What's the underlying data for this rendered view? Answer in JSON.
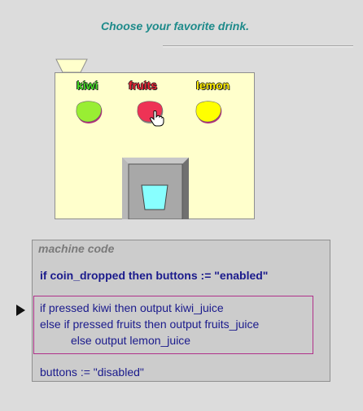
{
  "prompt": "Choose your favorite drink.",
  "machine": {
    "drinks": [
      {
        "label": "kiwi",
        "color": "#99ee33",
        "label_color": "#44dd22"
      },
      {
        "label": "fruits",
        "color": "#ee3355",
        "label_color": "#ee2233"
      },
      {
        "label": "lemon",
        "color": "#ffff00",
        "label_color": "#ffee00"
      }
    ],
    "cup_color": "#88ffff"
  },
  "code": {
    "title": "machine code",
    "line1": "if coin_dropped then buttons := \"enabled\"",
    "box_lines": [
      "if pressed kiwi then output kiwi_juice",
      "else if pressed fruits then output fruits_juice",
      "else output lemon_juice"
    ],
    "last_line": "buttons := \"disabled\""
  },
  "colors": {
    "prompt": "#1d8a8a",
    "code_text": "#1a1a8c",
    "code_box_border": "#b0308a",
    "machine_body": "#ffffcc"
  }
}
